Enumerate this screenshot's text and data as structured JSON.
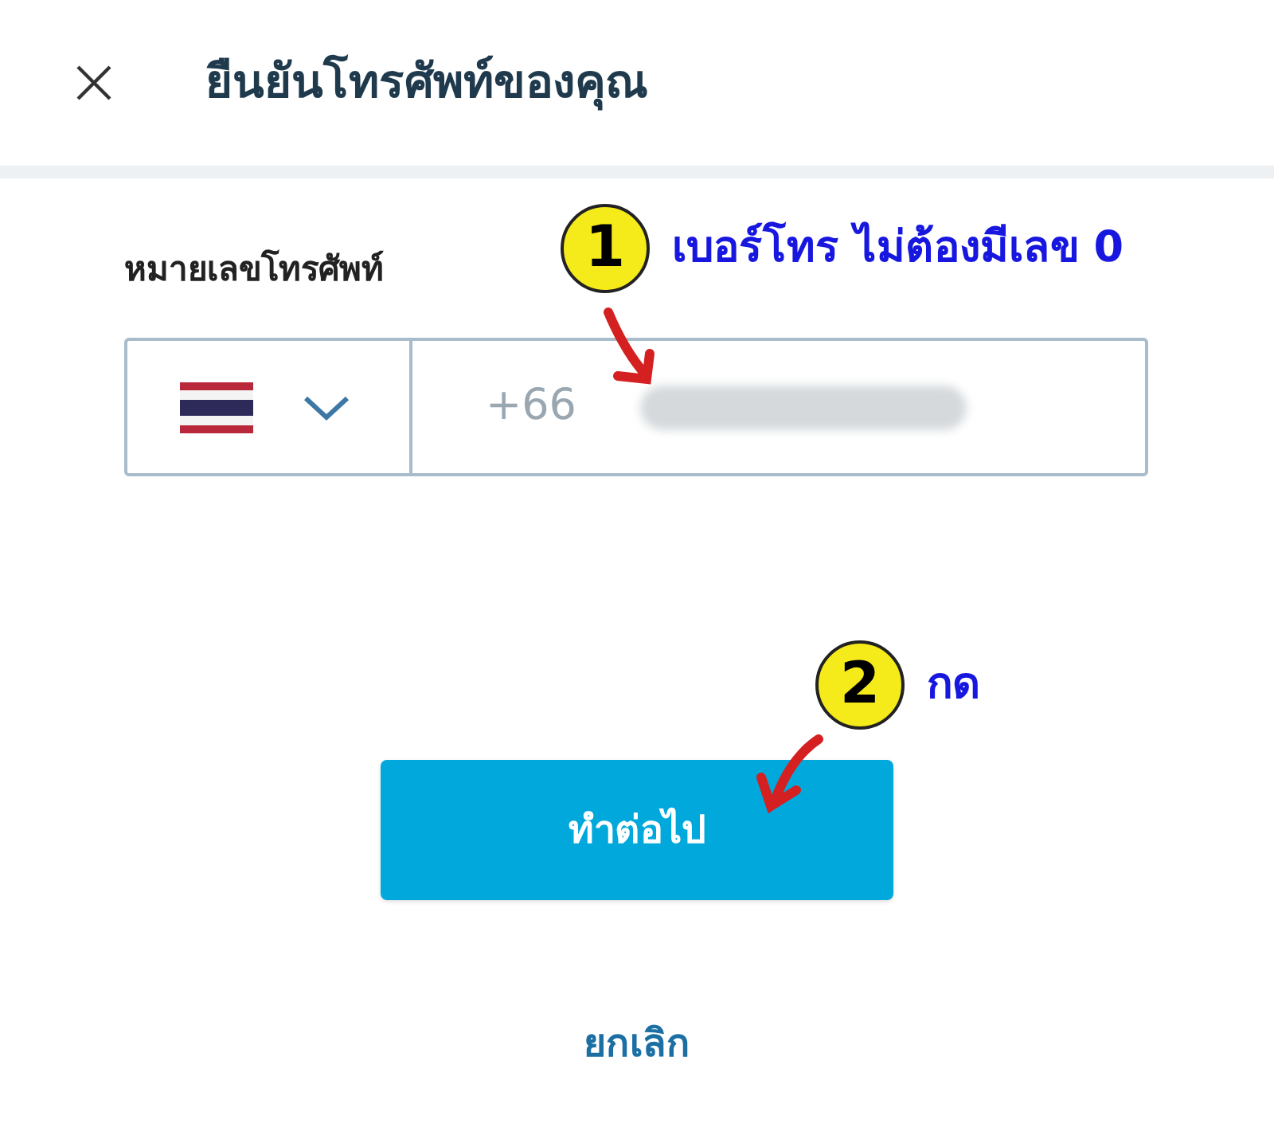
{
  "header": {
    "title": "ยืนยันโทรศัพท์ของคุณ"
  },
  "phone": {
    "label": "หมายเลขโทรศัพท์",
    "country_code": "+66"
  },
  "continue_button": {
    "label": "ทำต่อไป"
  },
  "cancel_link": {
    "label": "ยกเลิก"
  },
  "annotations": [
    {
      "number": "1",
      "text": "เบอร์โทร ไม่ต้องมีเลข 0"
    },
    {
      "number": "2",
      "text": "กด"
    }
  ]
}
